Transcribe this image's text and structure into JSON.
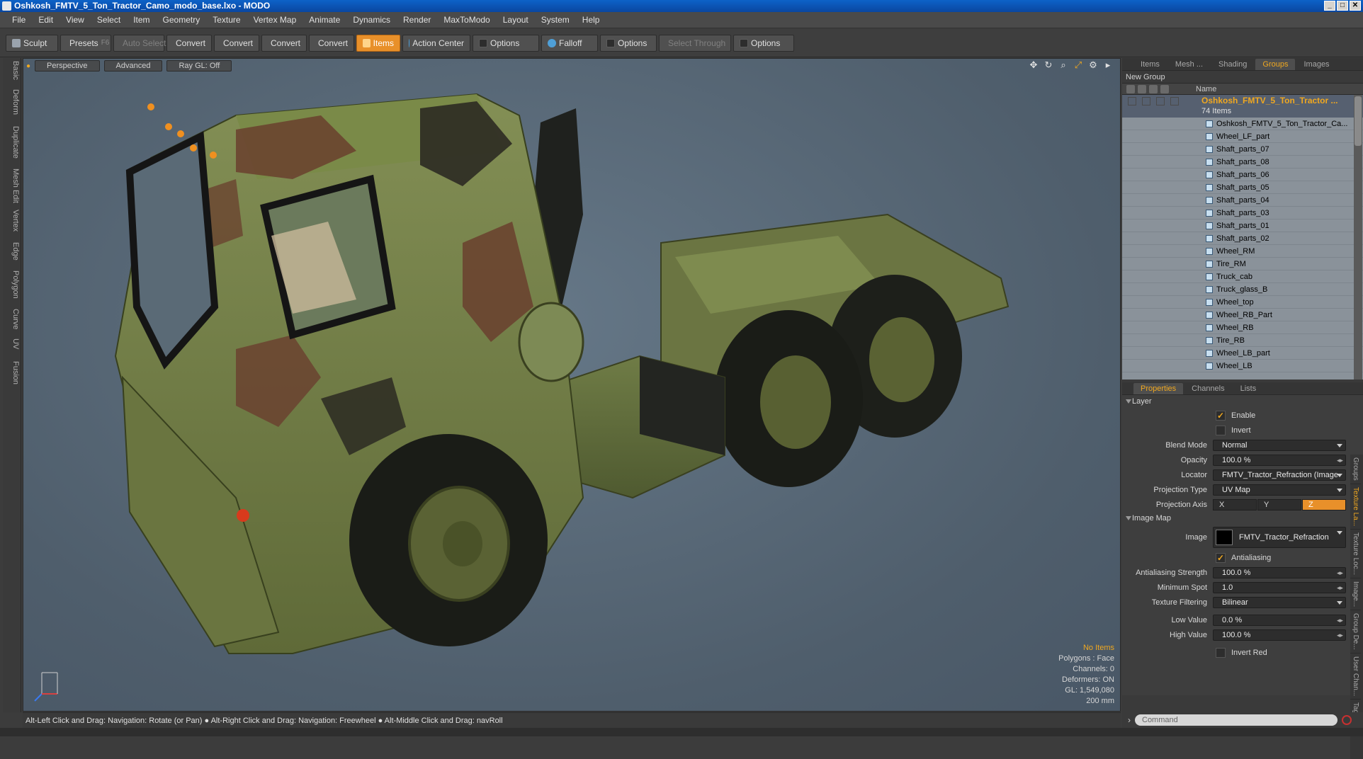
{
  "window": {
    "title": "Oshkosh_FMTV_5_Ton_Tractor_Camo_modo_base.lxo - MODO"
  },
  "menu": [
    "File",
    "Edit",
    "View",
    "Select",
    "Item",
    "Geometry",
    "Texture",
    "Vertex Map",
    "Animate",
    "Dynamics",
    "Render",
    "MaxToModo",
    "Layout",
    "System",
    "Help"
  ],
  "toolbar": {
    "sculpt": "Sculpt",
    "presets": "Presets",
    "presets_key": "F6",
    "auto_select": "Auto Select",
    "convert": "Convert",
    "items": "Items",
    "action_center": "Action Center",
    "options": "Options",
    "falloff": "Falloff",
    "select_through": "Select Through"
  },
  "left_tabs": [
    "Basic",
    "Deform",
    "Duplicate",
    "Mesh Edit",
    "Vertex",
    "Edge",
    "Polygon",
    "Curve",
    "UV",
    "Fusion"
  ],
  "viewport": {
    "perspective": "Perspective",
    "advanced": "Advanced",
    "raygl": "Ray GL: Off",
    "stats": {
      "no_items": "No Items",
      "polygons": "Polygons : Face",
      "channels": "Channels: 0",
      "deformers": "Deformers: ON",
      "gl": "GL: 1,549,080",
      "scale": "200 mm"
    }
  },
  "status": "Alt-Left Click and Drag: Navigation: Rotate (or Pan) ● Alt-Right Click and Drag: Navigation: Freewheel ● Alt-Middle Click and Drag: navRoll",
  "top_tabs": [
    "Items",
    "Mesh ...",
    "Shading",
    "Groups",
    "Images"
  ],
  "new_group": "New Group",
  "name_col": "Name",
  "group": {
    "name": "Oshkosh_FMTV_5_Ton_Tractor ...",
    "count": "74 Items"
  },
  "items": [
    "Oshkosh_FMTV_5_Ton_Tractor_Ca...",
    "Wheel_LF_part",
    "Shaft_parts_07",
    "Shaft_parts_08",
    "Shaft_parts_06",
    "Shaft_parts_05",
    "Shaft_parts_04",
    "Shaft_parts_03",
    "Shaft_parts_01",
    "Shaft_parts_02",
    "Wheel_RM",
    "Tire_RM",
    "Truck_cab",
    "Truck_glass_B",
    "Wheel_top",
    "Wheel_RB_Part",
    "Wheel_RB",
    "Tire_RB",
    "Wheel_LB_part",
    "Wheel_LB"
  ],
  "prop_tabs": [
    "Properties",
    "Channels",
    "Lists"
  ],
  "props": {
    "layer": "Layer",
    "enable": "Enable",
    "invert": "Invert",
    "blend_mode_label": "Blend Mode",
    "blend_mode": "Normal",
    "opacity_label": "Opacity",
    "opacity": "100.0 %",
    "locator_label": "Locator",
    "locator": "FMTV_Tractor_Refraction (Image ...",
    "projection_type_label": "Projection Type",
    "projection_type": "UV Map",
    "projection_axis_label": "Projection Axis",
    "axis_x": "X",
    "axis_y": "Y",
    "axis_z": "Z",
    "image_map": "Image Map",
    "image_label": "Image",
    "image": "FMTV_Tractor_Refraction",
    "antialiasing": "Antialiasing",
    "aa_strength_label": "Antialiasing Strength",
    "aa_strength": "100.0 %",
    "min_spot_label": "Minimum Spot",
    "min_spot": "1.0",
    "tex_filter_label": "Texture Filtering",
    "tex_filter": "Bilinear",
    "low_value_label": "Low Value",
    "low_value": "0.0 %",
    "high_value_label": "High Value",
    "high_value": "100.0 %",
    "invert_red": "Invert Red"
  },
  "right_vtabs": [
    "Groups",
    "Texture La...",
    "Texture Loc...",
    "Image...",
    "Group De...",
    "User Chan...",
    "Tags"
  ],
  "command_placeholder": "Command"
}
